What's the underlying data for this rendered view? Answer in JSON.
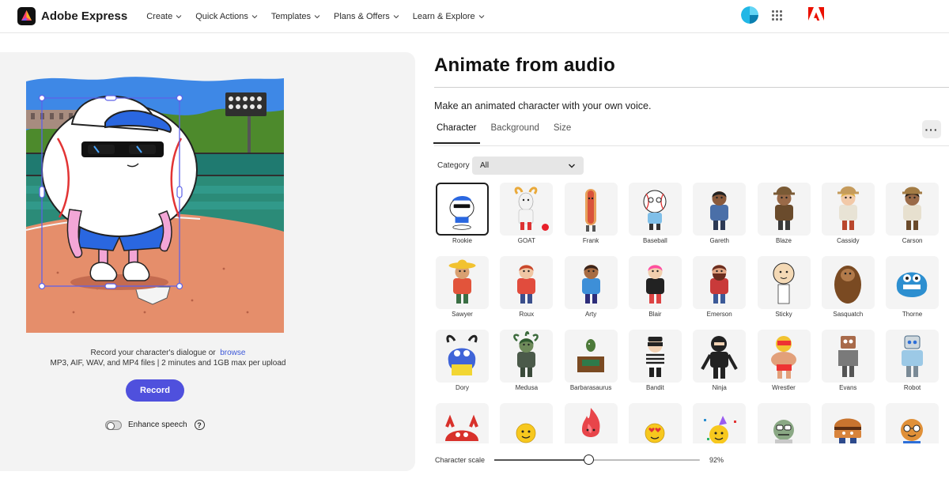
{
  "app": {
    "name": "Adobe Express"
  },
  "nav": [
    {
      "label": "Create"
    },
    {
      "label": "Quick Actions"
    },
    {
      "label": "Templates"
    },
    {
      "label": "Plans & Offers"
    },
    {
      "label": "Learn & Explore"
    }
  ],
  "preview": {
    "upload_prefix": "Record your character's dialogue or",
    "browse_link": "browse",
    "upload_note": "MP3, AIF, WAV, and MP4 files | 2 minutes and 1GB max per upload",
    "record_label": "Record",
    "enhance_label": "Enhance speech",
    "enhance_on": false,
    "help_glyph": "?"
  },
  "panel": {
    "title": "Animate from audio",
    "subtitle": "Make an animated character with your own voice.",
    "tabs": [
      {
        "label": "Character",
        "active": true
      },
      {
        "label": "Background",
        "active": false
      },
      {
        "label": "Size",
        "active": false
      }
    ],
    "more_glyph": "···",
    "category_label": "Category",
    "category_value": "All"
  },
  "characters": [
    {
      "name": "Rookie",
      "selected": true,
      "icon": "baseball-mascot"
    },
    {
      "name": "GOAT",
      "badge": "red-dot",
      "icon": "goat"
    },
    {
      "name": "Frank",
      "icon": "hotdog"
    },
    {
      "name": "Baseball",
      "icon": "baseball-face"
    },
    {
      "name": "Gareth",
      "icon": "man-blue-shirt"
    },
    {
      "name": "Blaze",
      "icon": "cowboy"
    },
    {
      "name": "Cassidy",
      "icon": "cowgirl"
    },
    {
      "name": "Carson",
      "icon": "cowboy-vest"
    },
    {
      "name": "Sawyer",
      "icon": "sombrero-man"
    },
    {
      "name": "Roux",
      "icon": "girl-red-hair"
    },
    {
      "name": "Arty",
      "icon": "boy-curly-hair"
    },
    {
      "name": "Blair",
      "icon": "pink-hair-girl"
    },
    {
      "name": "Emerson",
      "icon": "bearded-man"
    },
    {
      "name": "Sticky",
      "icon": "stick-figure"
    },
    {
      "name": "Sasquatch",
      "icon": "bigfoot"
    },
    {
      "name": "Thorne",
      "icon": "blue-monster"
    },
    {
      "name": "Dory",
      "icon": "horned-monster"
    },
    {
      "name": "Medusa",
      "icon": "medusa"
    },
    {
      "name": "Barbarasaurus",
      "icon": "dino-desk"
    },
    {
      "name": "Bandit",
      "icon": "bandit"
    },
    {
      "name": "Ninja",
      "icon": "ninja"
    },
    {
      "name": "Wrestler",
      "icon": "wrestler"
    },
    {
      "name": "Evans",
      "icon": "rusty-robot"
    },
    {
      "name": "Robot",
      "icon": "robot"
    },
    {
      "name": "",
      "icon": "red-crab"
    },
    {
      "name": "",
      "icon": "yellow-emoji"
    },
    {
      "name": "",
      "icon": "fire-blob"
    },
    {
      "name": "",
      "icon": "heart-eyes-emoji"
    },
    {
      "name": "",
      "icon": "party-emoji"
    },
    {
      "name": "",
      "icon": "zombie-head"
    },
    {
      "name": "",
      "icon": "burger-face"
    },
    {
      "name": "",
      "icon": "cookie-glasses"
    }
  ],
  "scale": {
    "label": "Character scale",
    "value_text": "92%",
    "fraction": 0.46
  },
  "colors": {
    "accent": "#4f50dd",
    "link": "#3d58d8"
  }
}
